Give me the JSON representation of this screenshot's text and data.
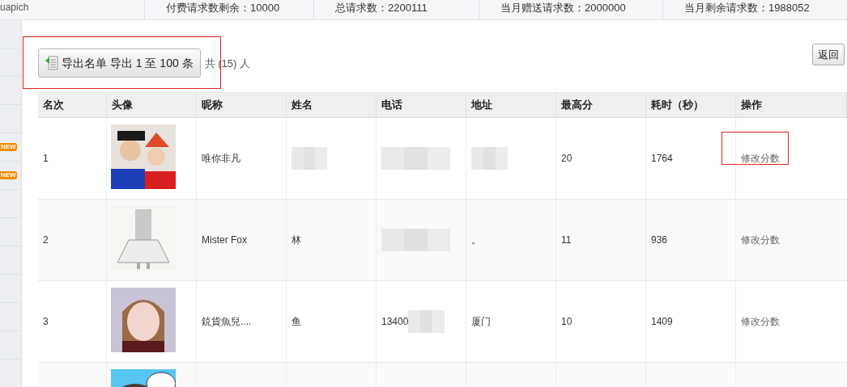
{
  "top_bar": {
    "account": "uapich",
    "stats": [
      "付费请求数剩余：10000",
      "总请求数：2200111",
      "当月赠送请求数：2000000",
      "当月剩余请求数：1988052"
    ]
  },
  "sidebar": {
    "badges": [
      "NEW",
      "NEW"
    ]
  },
  "toolbar": {
    "export_button": "导出名单 导出 1 至 100 条",
    "total": "共 (15) 人",
    "back_button": "返回",
    "annotated": true
  },
  "table": {
    "columns": [
      "名次",
      "头像",
      "昵称",
      "姓名",
      "电话",
      "地址",
      "最高分",
      "耗时（秒）",
      "操作"
    ],
    "rows": [
      {
        "rank": "1",
        "nickname": "唯你非凡",
        "name": "",
        "name_redacted": true,
        "phone": "",
        "phone_redacted": true,
        "address": "",
        "address_redacted": true,
        "score": "20",
        "time": "1764",
        "action": "修改分数",
        "annotated": true
      },
      {
        "rank": "2",
        "nickname": "Mister Fox",
        "name": "林",
        "name_redacted": false,
        "phone": "",
        "phone_redacted": true,
        "address": "。",
        "address_redacted": false,
        "score": "11",
        "time": "936",
        "action": "修改分数",
        "annotated": false
      },
      {
        "rank": "3",
        "nickname": "鋴貨魚兒....",
        "name": "鱼",
        "name_redacted": false,
        "phone": "13400",
        "phone_redacted": true,
        "address": "厦门",
        "address_redacted": false,
        "score": "10",
        "time": "1409",
        "action": "修改分数",
        "annotated": false
      },
      {
        "name_redacted": false,
        "phone_redacted": false,
        "address_redacted": false,
        "annotated": false
      }
    ]
  }
}
